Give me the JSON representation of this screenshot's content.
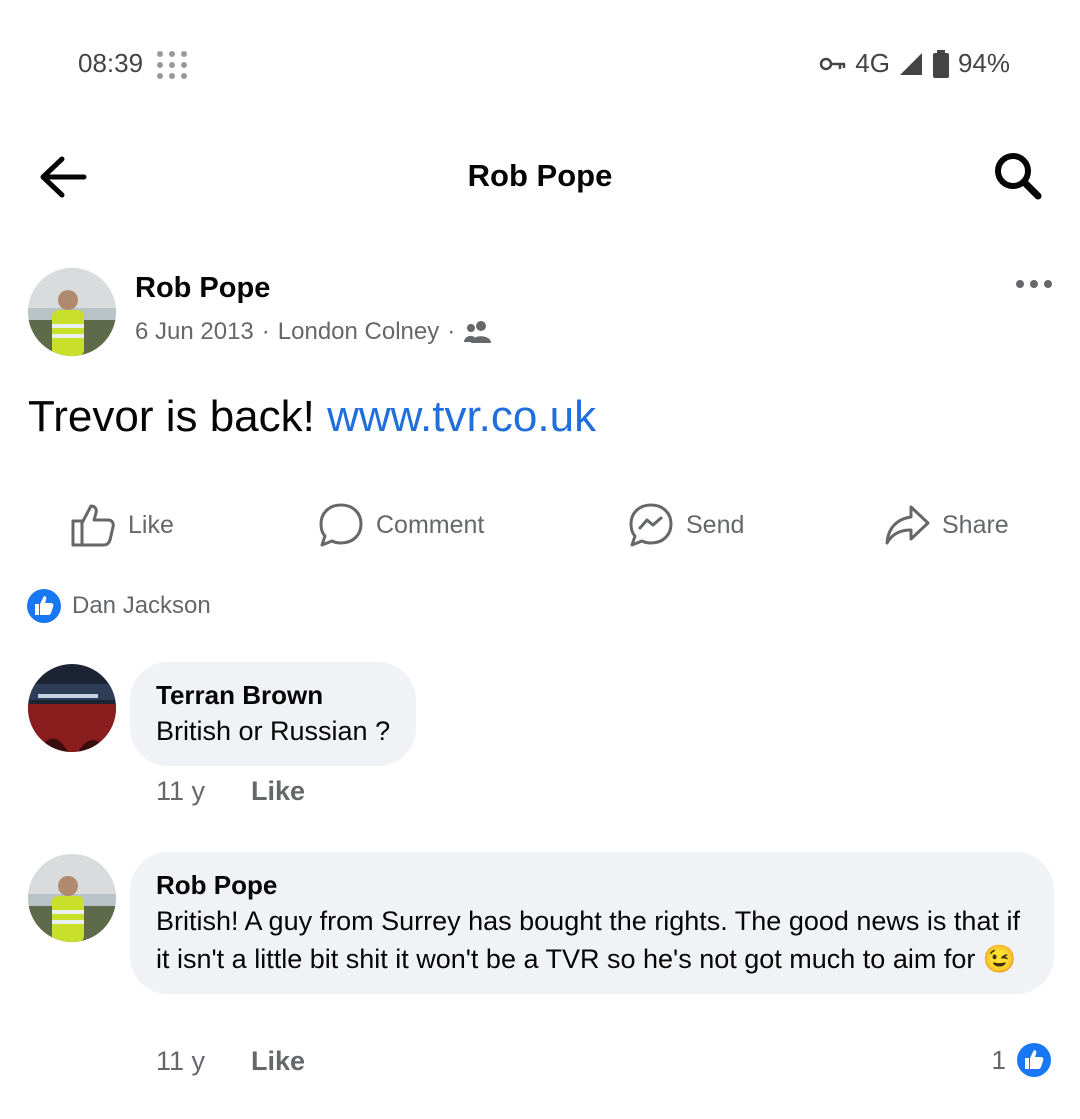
{
  "status_bar": {
    "time": "08:39",
    "network": "4G",
    "battery": "94%"
  },
  "header": {
    "title": "Rob Pope"
  },
  "post": {
    "author": "Rob Pope",
    "date": "6 Jun 2013",
    "location": "London Colney",
    "separator": "·",
    "text": "Trevor is back! ",
    "link": "www.tvr.co.uk"
  },
  "actions": {
    "like": "Like",
    "comment": "Comment",
    "send": "Send",
    "share": "Share"
  },
  "reactions": {
    "names": "Dan Jackson"
  },
  "comments": [
    {
      "author": "Terran Brown",
      "text": "British or Russian ?",
      "age": "11 y",
      "like_label": "Like"
    },
    {
      "author": "Rob Pope",
      "text": "British! A guy from Surrey has bought the rights. The good news is that if it isn't a little bit shit it won't be a TVR so he's not got much to aim for 😉",
      "age": "11 y",
      "like_label": "Like",
      "like_count": "1"
    }
  ],
  "colors": {
    "link": "#216fdb",
    "like_badge": "#1877f2",
    "bubble": "#f0f2f5",
    "muted": "#65676b"
  }
}
